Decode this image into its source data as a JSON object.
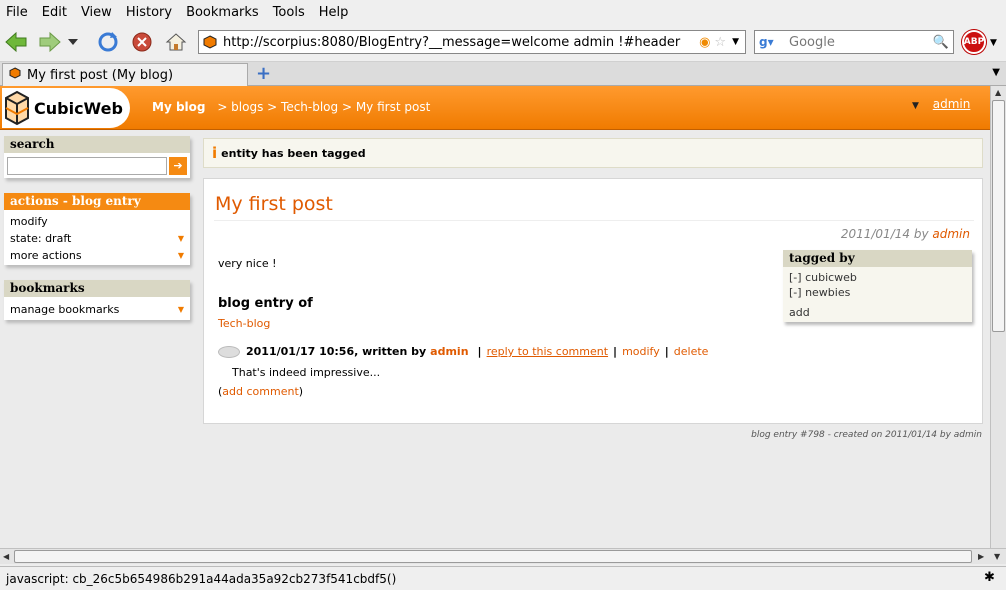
{
  "menu": [
    "File",
    "Edit",
    "View",
    "History",
    "Bookmarks",
    "Tools",
    "Help"
  ],
  "url": "http://scorpius:8080/BlogEntry?__message=welcome admin !#header",
  "search_placeholder": "Google",
  "tab_title": "My first post (My blog)",
  "status_text": "javascript: cb_26c5b654986b291a44ada35a92cb273f541cbdf5()",
  "header": {
    "logo": "CubicWeb",
    "site": "My blog",
    "crumbs": "> blogs > Tech-blog > My first post",
    "user": "admin"
  },
  "sidebar": {
    "search_title": "search",
    "actions_title": "actions - blog entry",
    "actions": [
      "modify",
      "state: draft",
      "more actions"
    ],
    "bookmarks_title": "bookmarks",
    "bookmarks": [
      "manage bookmarks"
    ]
  },
  "message": "entity has been tagged",
  "post": {
    "title": "My first post",
    "date": "2011/01/14",
    "by": "by",
    "author": "admin",
    "body": "very nice !",
    "entry_of_heading": "blog entry of",
    "blog": "Tech-blog",
    "comment": {
      "date": "2011/01/17 10:56, written by",
      "author": "admin",
      "reply": "reply to this comment",
      "modify": "modify",
      "delete": "delete",
      "text": "That's indeed impressive...",
      "add": "add comment"
    }
  },
  "tagged": {
    "title": "tagged by",
    "tags": [
      "cubicweb",
      "newbies"
    ],
    "add": "add"
  },
  "footer": "blog entry #798 - created on 2011/01/14 by admin",
  "colors": {
    "accent": "#f07b00",
    "link": "#e05a00"
  }
}
